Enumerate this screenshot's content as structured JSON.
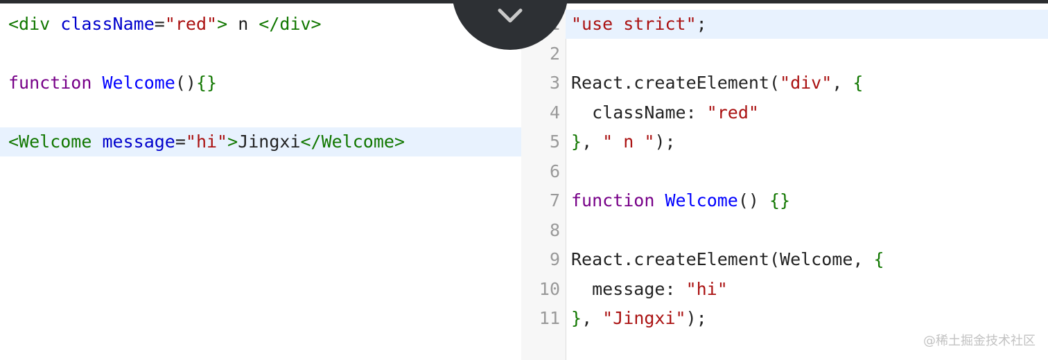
{
  "left_editor": {
    "lines": [
      {
        "tokens": [
          {
            "t": "<div",
            "c": "tag"
          },
          {
            "t": " ",
            "c": "punc"
          },
          {
            "t": "className",
            "c": "attr"
          },
          {
            "t": "=",
            "c": "punc"
          },
          {
            "t": "\"red\"",
            "c": "str"
          },
          {
            "t": ">",
            "c": "tag"
          },
          {
            "t": " n ",
            "c": "punc"
          },
          {
            "t": "</div>",
            "c": "tag"
          }
        ]
      },
      {
        "tokens": []
      },
      {
        "tokens": [
          {
            "t": "function",
            "c": "kw"
          },
          {
            "t": " ",
            "c": "punc"
          },
          {
            "t": "Welcome",
            "c": "def"
          },
          {
            "t": "()",
            "c": "punc"
          },
          {
            "t": "{}",
            "c": "br"
          }
        ]
      },
      {
        "tokens": []
      },
      {
        "highlight": true,
        "tokens": [
          {
            "t": "<Welcome",
            "c": "tag"
          },
          {
            "t": " ",
            "c": "punc"
          },
          {
            "t": "message",
            "c": "attr"
          },
          {
            "t": "=",
            "c": "punc"
          },
          {
            "t": "\"hi\"",
            "c": "str"
          },
          {
            "t": ">",
            "c": "tag"
          },
          {
            "t": "Jingxi",
            "c": "punc"
          },
          {
            "t": "</Welcome>",
            "c": "tag"
          }
        ]
      }
    ]
  },
  "right_editor": {
    "lines": [
      {
        "num": "1",
        "highlight": true,
        "tokens": [
          {
            "t": "\"use strict\"",
            "c": "str"
          },
          {
            "t": ";",
            "c": "punc"
          }
        ]
      },
      {
        "num": "2",
        "tokens": []
      },
      {
        "num": "3",
        "tokens": [
          {
            "t": "React.createElement(",
            "c": "punc"
          },
          {
            "t": "\"div\"",
            "c": "str"
          },
          {
            "t": ", ",
            "c": "punc"
          },
          {
            "t": "{",
            "c": "br"
          }
        ]
      },
      {
        "num": "4",
        "tokens": [
          {
            "t": "  className: ",
            "c": "punc"
          },
          {
            "t": "\"red\"",
            "c": "str"
          }
        ]
      },
      {
        "num": "5",
        "tokens": [
          {
            "t": "}",
            "c": "br"
          },
          {
            "t": ", ",
            "c": "punc"
          },
          {
            "t": "\" n \"",
            "c": "str"
          },
          {
            "t": ");",
            "c": "punc"
          }
        ]
      },
      {
        "num": "6",
        "tokens": []
      },
      {
        "num": "7",
        "tokens": [
          {
            "t": "function",
            "c": "kw"
          },
          {
            "t": " ",
            "c": "punc"
          },
          {
            "t": "Welcome",
            "c": "def"
          },
          {
            "t": "() ",
            "c": "punc"
          },
          {
            "t": "{}",
            "c": "br"
          }
        ]
      },
      {
        "num": "8",
        "tokens": []
      },
      {
        "num": "9",
        "tokens": [
          {
            "t": "React.createElement(Welcome, ",
            "c": "punc"
          },
          {
            "t": "{",
            "c": "br"
          }
        ]
      },
      {
        "num": "10",
        "tokens": [
          {
            "t": "  message: ",
            "c": "punc"
          },
          {
            "t": "\"hi\"",
            "c": "str"
          }
        ]
      },
      {
        "num": "11",
        "tokens": [
          {
            "t": "}",
            "c": "br"
          },
          {
            "t": ", ",
            "c": "punc"
          },
          {
            "t": "\"Jingxi\"",
            "c": "str"
          },
          {
            "t": ");",
            "c": "punc"
          }
        ]
      }
    ]
  },
  "collapse_button": {
    "icon": "chevron-down-icon"
  },
  "watermark": {
    "text": "@稀土掘金技术社区"
  },
  "colors": {
    "tag": "#117700",
    "attr": "#0000cc",
    "string": "#aa1111",
    "keyword": "#770088",
    "definition": "#0000ff",
    "line_highlight": "#e8f2fe",
    "gutter_bg": "#f7f7f7",
    "topbar": "#2b2d30"
  }
}
